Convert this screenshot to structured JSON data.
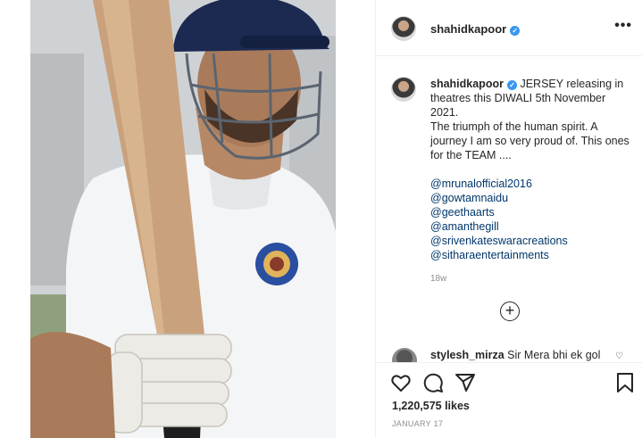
{
  "header": {
    "username": "shahidkapoor",
    "more_label": "•••"
  },
  "caption": {
    "username": "shahidkapoor",
    "text": "JERSEY releasing in theatres this DIWALI 5th November 2021.",
    "text2": "The triumph of the human spirit. A journey I am so very proud of. This ones for the TEAM ....",
    "mentions": [
      "@mrunalofficial2016",
      "@gowtamnaidu",
      "@geethaarts",
      "@amanthegill",
      "@srivenkateswaracreations",
      "@sitharaentertainments"
    ],
    "age": "18w"
  },
  "load_more_icon": "plus-circle-icon",
  "comment": {
    "username": "stylesh_mirza",
    "text": "Sir Mera bhi ek gol"
  },
  "actions": {
    "likes": "1,220,575 likes",
    "date": "JANUARY 17"
  },
  "icons": [
    "heart-icon",
    "comment-icon",
    "share-icon",
    "bookmark-icon",
    "verified-icon",
    "more-icon"
  ],
  "colors": {
    "verified": "#3897f0",
    "mention": "#00376b",
    "muted": "#8e8e8e",
    "text": "#262626"
  }
}
